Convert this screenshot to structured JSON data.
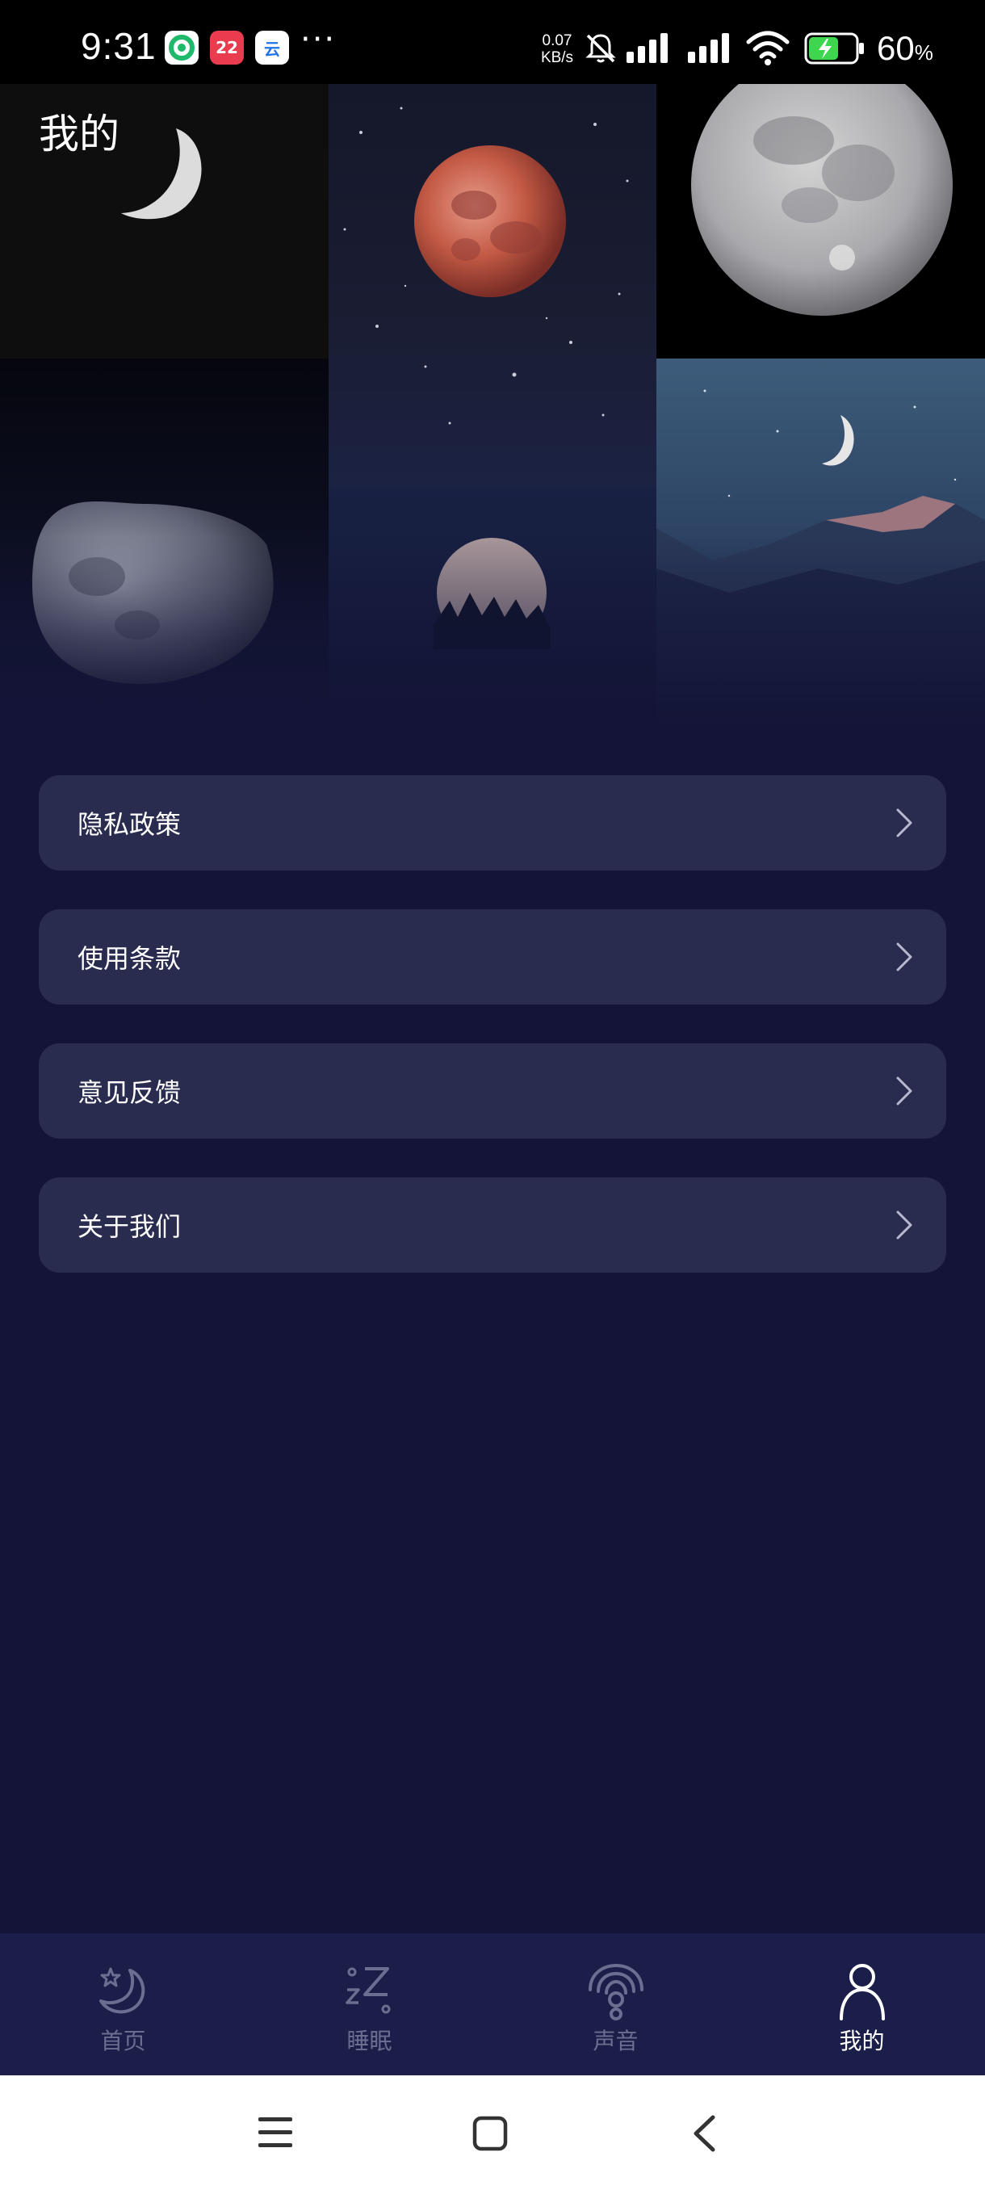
{
  "status_bar": {
    "time": "9:31",
    "notification_icons": [
      {
        "name": "swirl-app-icon",
        "color": "#1fb96b"
      },
      {
        "name": "calendar-app-icon",
        "text": "22",
        "color": "#ea3c4f"
      },
      {
        "name": "cloud-app-icon",
        "text": "云",
        "color": "#1f74e6"
      }
    ],
    "more": "···",
    "net_speed_value": "0.07",
    "net_speed_unit": "KB/s",
    "battery_percent": "60",
    "battery_unit": "%"
  },
  "header": {
    "title": "我的"
  },
  "menu": {
    "items": [
      {
        "label": "隐私政策"
      },
      {
        "label": "使用条款"
      },
      {
        "label": "意见反馈"
      },
      {
        "label": "关于我们"
      }
    ]
  },
  "tab_bar": {
    "active_color": "#ffffff",
    "inactive_color": "#6b6e90",
    "tabs": [
      {
        "label": "首页",
        "icon": "moon-star-icon",
        "active": false
      },
      {
        "label": "睡眠",
        "icon": "zzz-icon",
        "active": false
      },
      {
        "label": "声音",
        "icon": "sound-wave-icon",
        "active": false
      },
      {
        "label": "我的",
        "icon": "person-icon",
        "active": true
      }
    ]
  },
  "colors": {
    "background": "#131437",
    "card": "#292b4f",
    "tab_bar": "#1c1e4a"
  }
}
